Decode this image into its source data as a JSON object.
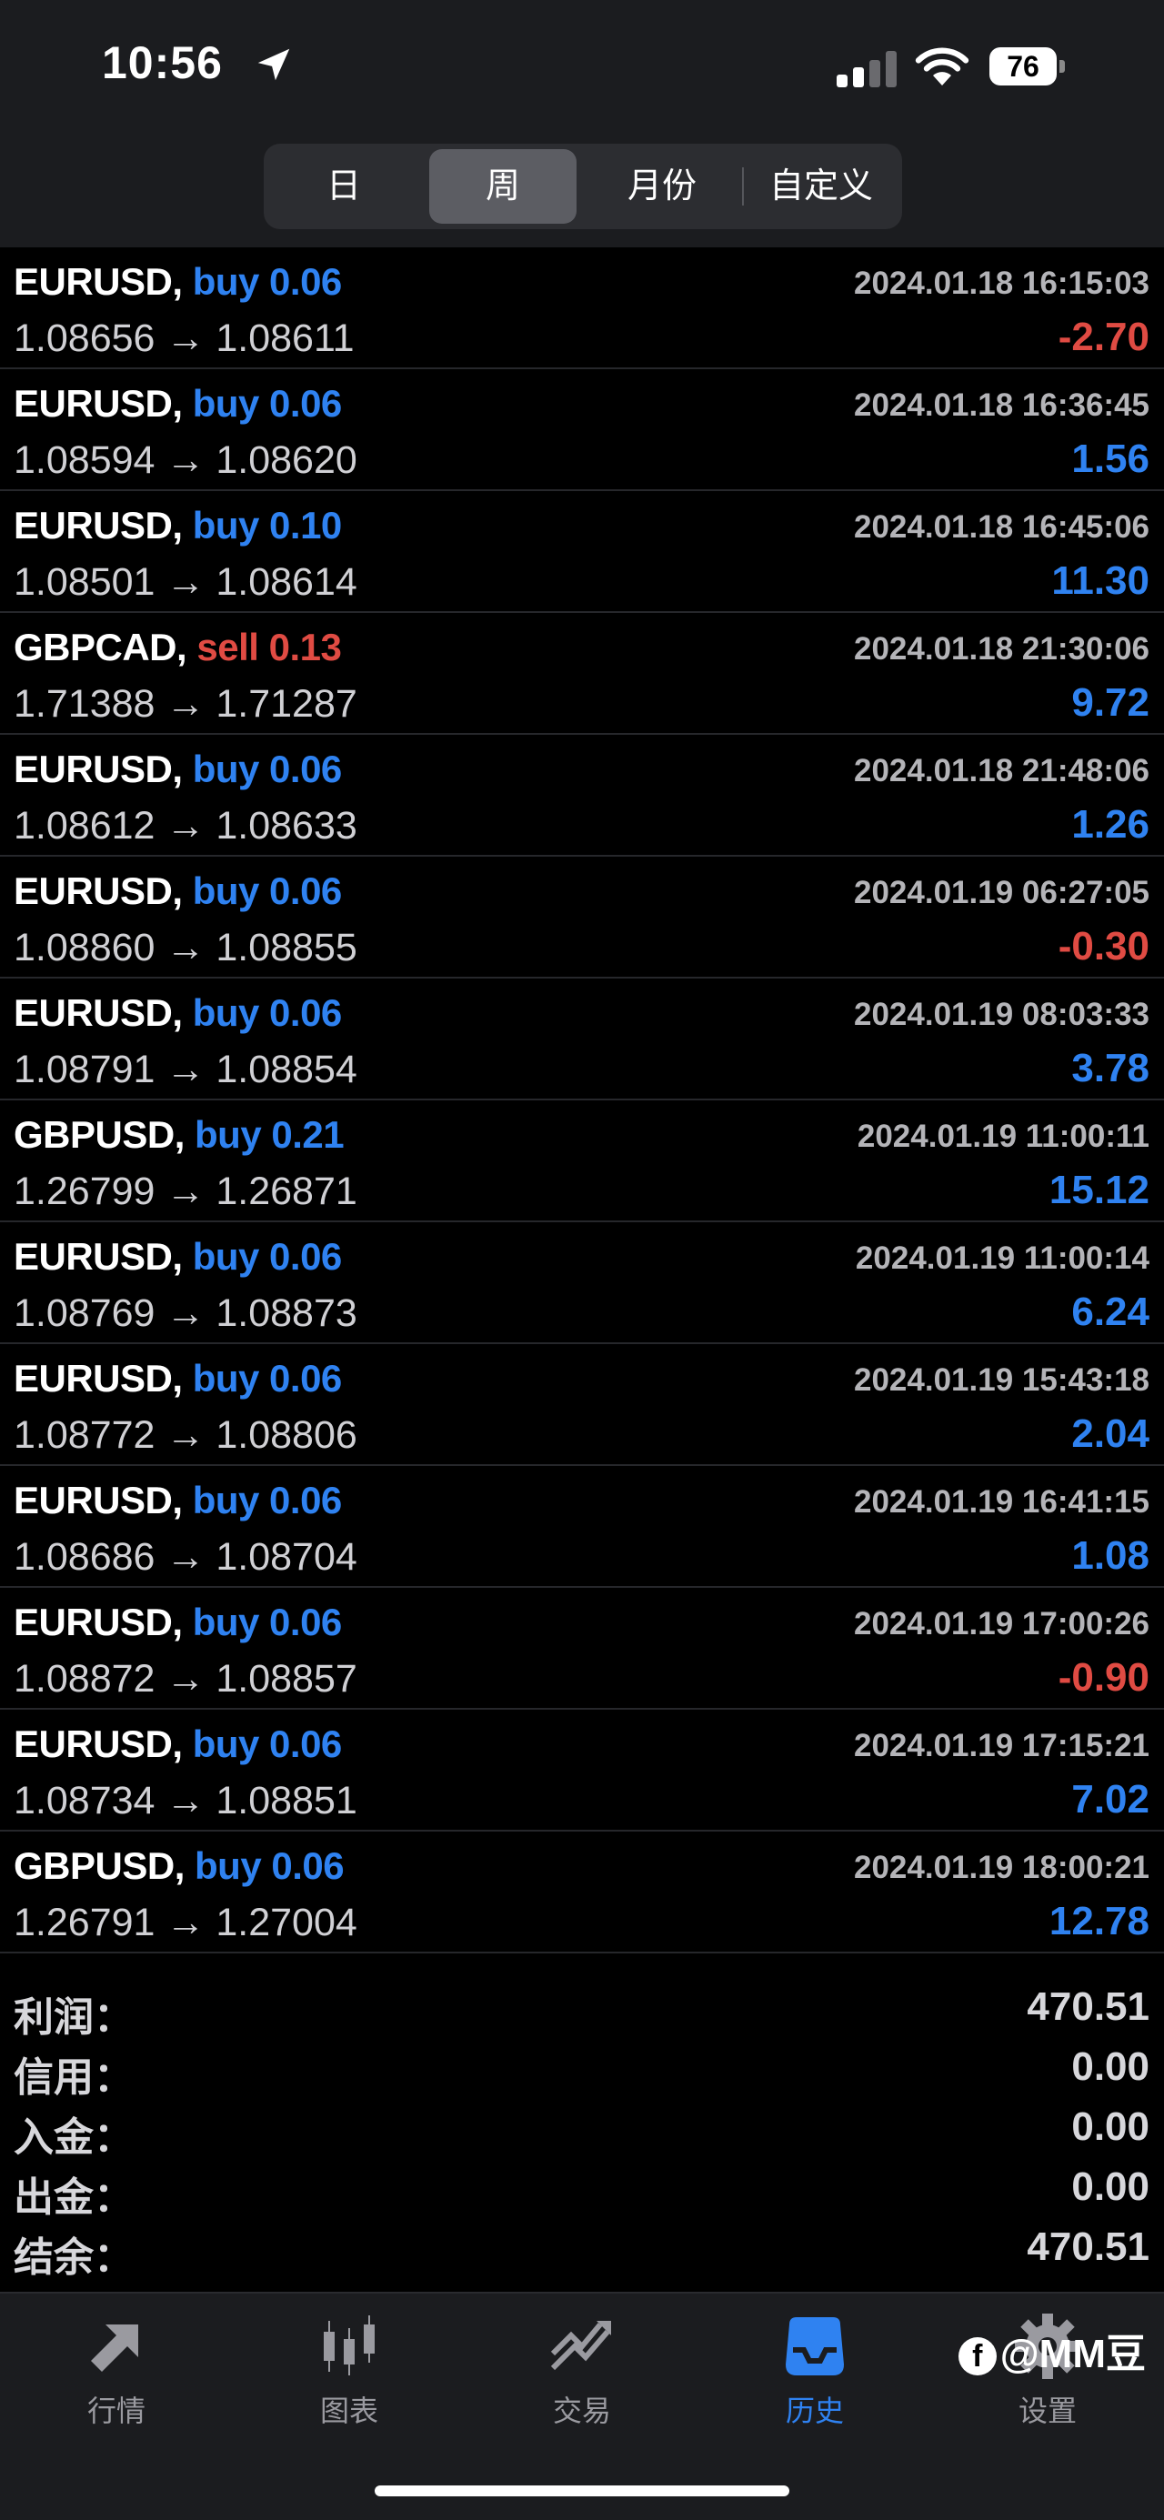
{
  "status_bar": {
    "time": "10:56",
    "battery": "76"
  },
  "segments": [
    {
      "label": "日",
      "active": false
    },
    {
      "label": "周",
      "active": true
    },
    {
      "label": "月份",
      "active": false
    },
    {
      "label": "自定义",
      "active": false
    }
  ],
  "trades": [
    {
      "symbol": "EURUSD,",
      "side": "buy",
      "volume": "0.06",
      "datetime": "2024.01.18 16:15:03",
      "open": "1.08656",
      "close": "1.08611",
      "profit": "-2.70"
    },
    {
      "symbol": "EURUSD,",
      "side": "buy",
      "volume": "0.06",
      "datetime": "2024.01.18 16:36:45",
      "open": "1.08594",
      "close": "1.08620",
      "profit": "1.56"
    },
    {
      "symbol": "EURUSD,",
      "side": "buy",
      "volume": "0.10",
      "datetime": "2024.01.18 16:45:06",
      "open": "1.08501",
      "close": "1.08614",
      "profit": "11.30"
    },
    {
      "symbol": "GBPCAD,",
      "side": "sell",
      "volume": "0.13",
      "datetime": "2024.01.18 21:30:06",
      "open": "1.71388",
      "close": "1.71287",
      "profit": "9.72"
    },
    {
      "symbol": "EURUSD,",
      "side": "buy",
      "volume": "0.06",
      "datetime": "2024.01.18 21:48:06",
      "open": "1.08612",
      "close": "1.08633",
      "profit": "1.26"
    },
    {
      "symbol": "EURUSD,",
      "side": "buy",
      "volume": "0.06",
      "datetime": "2024.01.19 06:27:05",
      "open": "1.08860",
      "close": "1.08855",
      "profit": "-0.30"
    },
    {
      "symbol": "EURUSD,",
      "side": "buy",
      "volume": "0.06",
      "datetime": "2024.01.19 08:03:33",
      "open": "1.08791",
      "close": "1.08854",
      "profit": "3.78"
    },
    {
      "symbol": "GBPUSD,",
      "side": "buy",
      "volume": "0.21",
      "datetime": "2024.01.19 11:00:11",
      "open": "1.26799",
      "close": "1.26871",
      "profit": "15.12"
    },
    {
      "symbol": "EURUSD,",
      "side": "buy",
      "volume": "0.06",
      "datetime": "2024.01.19 11:00:14",
      "open": "1.08769",
      "close": "1.08873",
      "profit": "6.24"
    },
    {
      "symbol": "EURUSD,",
      "side": "buy",
      "volume": "0.06",
      "datetime": "2024.01.19 15:43:18",
      "open": "1.08772",
      "close": "1.08806",
      "profit": "2.04"
    },
    {
      "symbol": "EURUSD,",
      "side": "buy",
      "volume": "0.06",
      "datetime": "2024.01.19 16:41:15",
      "open": "1.08686",
      "close": "1.08704",
      "profit": "1.08"
    },
    {
      "symbol": "EURUSD,",
      "side": "buy",
      "volume": "0.06",
      "datetime": "2024.01.19 17:00:26",
      "open": "1.08872",
      "close": "1.08857",
      "profit": "-0.90"
    },
    {
      "symbol": "EURUSD,",
      "side": "buy",
      "volume": "0.06",
      "datetime": "2024.01.19 17:15:21",
      "open": "1.08734",
      "close": "1.08851",
      "profit": "7.02"
    },
    {
      "symbol": "GBPUSD,",
      "side": "buy",
      "volume": "0.06",
      "datetime": "2024.01.19 18:00:21",
      "open": "1.26791",
      "close": "1.27004",
      "profit": "12.78"
    }
  ],
  "arrow": "→",
  "summary": [
    {
      "label": "利润：",
      "value": "470.51"
    },
    {
      "label": "信用：",
      "value": "0.00"
    },
    {
      "label": "入金：",
      "value": "0.00"
    },
    {
      "label": "出金：",
      "value": "0.00"
    },
    {
      "label": "结余：",
      "value": "470.51"
    }
  ],
  "tabs": [
    {
      "label": "行情",
      "icon": "quotes-arrows-icon",
      "active": false
    },
    {
      "label": "图表",
      "icon": "candlestick-chart-icon",
      "active": false
    },
    {
      "label": "交易",
      "icon": "trade-trend-icon",
      "active": false
    },
    {
      "label": "历史",
      "icon": "history-inbox-icon",
      "active": true
    },
    {
      "label": "设置",
      "icon": "gear-icon",
      "active": false
    }
  ],
  "watermark": "@MM豆",
  "colors": {
    "buy": "#2f82f1",
    "sell": "#e04b43",
    "active_tab": "#2f82f1",
    "inactive_tab": "#9a9aa0"
  }
}
